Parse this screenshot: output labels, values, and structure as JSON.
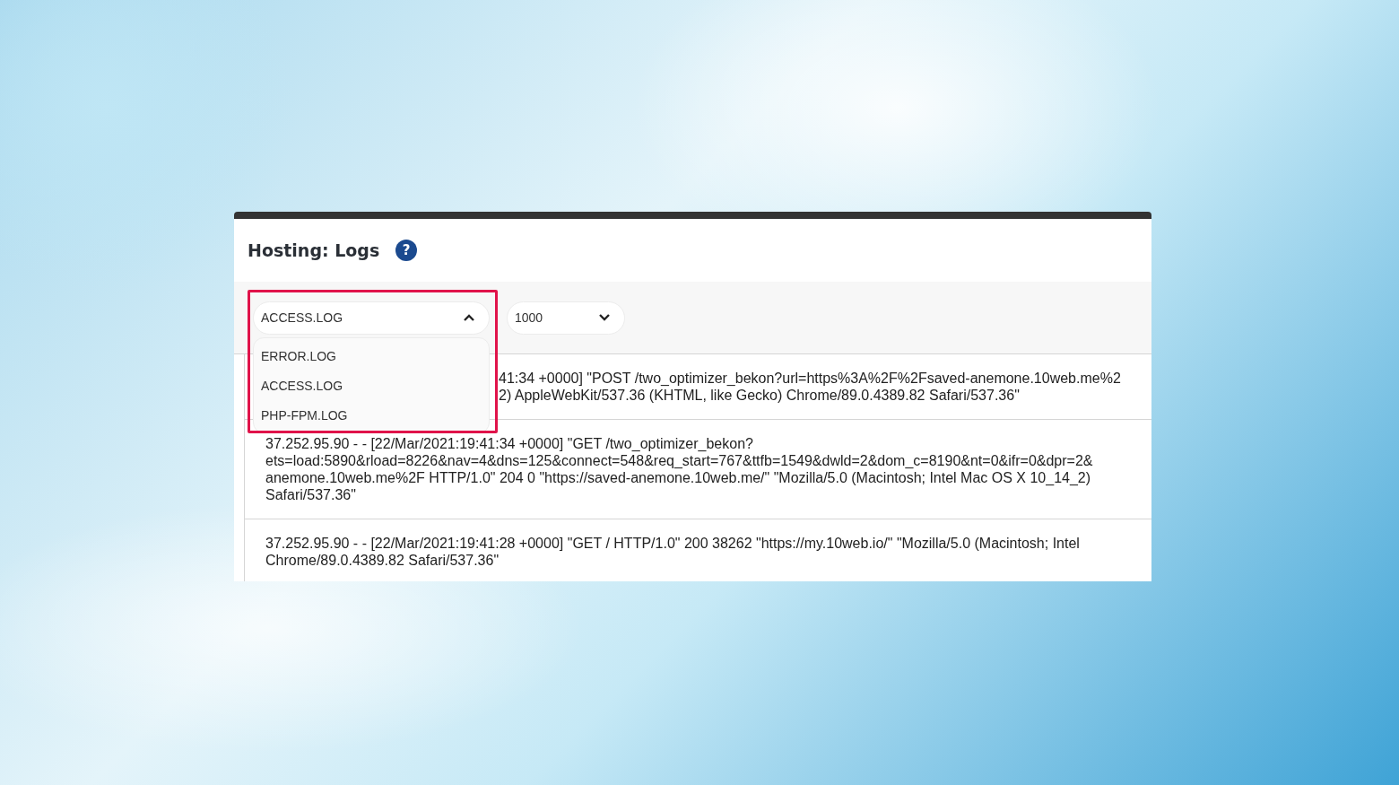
{
  "title": "Hosting: Logs",
  "help_glyph": "?",
  "file_select": {
    "value": "ACCESS.LOG",
    "expanded": true,
    "options": [
      {
        "label": "ERROR.LOG"
      },
      {
        "label": "ACCESS.LOG"
      },
      {
        "label": "PHP-FPM.LOG"
      }
    ]
  },
  "count_select": {
    "value": "1000",
    "expanded": false
  },
  "log_entries": [
    {
      "lines": [
        "41:34 +0000] \"POST /two_optimizer_bekon?url=https%3A%2F%2Fsaved-anemone.10web.me%2",
        "2) AppleWebKit/537.36 (KHTML, like Gecko) Chrome/89.0.4389.82 Safari/537.36\""
      ]
    },
    {
      "lines": [
        "37.252.95.90 - - [22/Mar/2021:19:41:34 +0000] \"GET /two_optimizer_bekon?",
        "ets=load:5890&rload=8226&nav=4&dns=125&connect=548&req_start=767&ttfb=1549&dwld=2&dom_c=8190&nt=0&ifr=0&dpr=2&",
        "anemone.10web.me%2F HTTP/1.0\" 204 0 \"https://saved-anemone.10web.me/\" \"Mozilla/5.0 (Macintosh; Intel Mac OS X 10_14_2)",
        "Safari/537.36\""
      ]
    },
    {
      "lines": [
        "37.252.95.90 - - [22/Mar/2021:19:41:28 +0000] \"GET / HTTP/1.0\" 200 38262 \"https://my.10web.io/\" \"Mozilla/5.0 (Macintosh; Intel",
        "Chrome/89.0.4389.82 Safari/537.36\""
      ]
    }
  ]
}
